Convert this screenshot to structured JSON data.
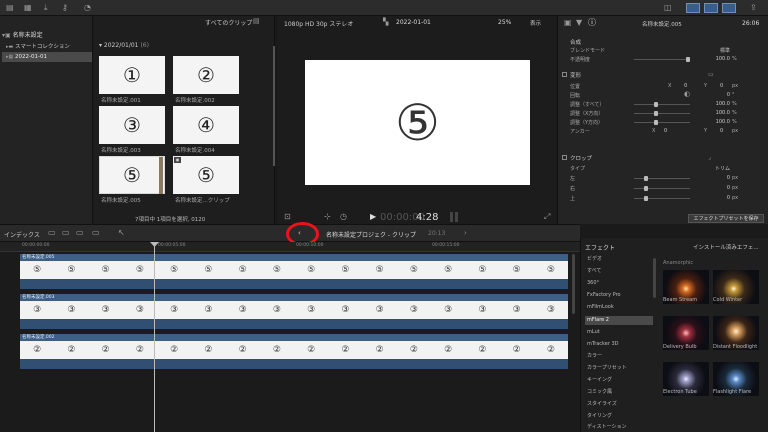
{
  "browser_header": {
    "dropdown": "すべてのクリップ"
  },
  "viewer_header": {
    "format": "1080p HD 30p ステレオ",
    "project": "2022-01-01",
    "zoom": "25%",
    "display": "表示"
  },
  "inspector_header": {
    "title": "名称未設定.005",
    "duration": "26:06"
  },
  "sidebar": {
    "library": "名称未設定",
    "items": [
      {
        "label": "スマートコレクション"
      },
      {
        "label": "2022-01-01"
      }
    ]
  },
  "browser": {
    "date_group": "2022/01/01",
    "date_count": "(6)",
    "clips": [
      {
        "glyph": "①",
        "caption": "名称未設定.001"
      },
      {
        "glyph": "②",
        "caption": "名称未設定.002"
      },
      {
        "glyph": "③",
        "caption": "名称未設定.003"
      },
      {
        "glyph": "④",
        "caption": "名称未設定.004"
      },
      {
        "glyph": "⑤",
        "caption": "名称未設定.005"
      },
      {
        "glyph": "⑤",
        "caption": "名称未設定...クリップ"
      }
    ],
    "status": "7項目中 1項目を選択, 0120"
  },
  "viewer": {
    "frame_glyph": "⑤",
    "timecode_dim": "00:00:00",
    "timecode": "4:28"
  },
  "inspector": {
    "sections": {
      "composite": "合成",
      "transform": "変形",
      "crop": "クロップ"
    },
    "rows": {
      "blend_mode": {
        "label": "ブレンドモード",
        "value": "標準"
      },
      "opacity": {
        "label": "不透明度",
        "value": "100.0",
        "unit": "%"
      },
      "position": {
        "label": "位置",
        "x": "X",
        "x_val": "0",
        "y": "Y",
        "y_val": "0",
        "unit": "px"
      },
      "rotation": {
        "label": "回転",
        "value": "0",
        "unit": "°"
      },
      "scale_all": {
        "label": "調整（すべて）",
        "value": "100.0",
        "unit": "%"
      },
      "scale_x": {
        "label": "調整（X方向）",
        "value": "100.0",
        "unit": "%"
      },
      "scale_y": {
        "label": "調整（Y方向）",
        "value": "100.0",
        "unit": "%"
      },
      "anchor": {
        "label": "アンカー",
        "x": "X",
        "x_val": "0",
        "y": "Y",
        "y_val": "0",
        "unit": "px"
      },
      "crop_type": {
        "label": "タイプ",
        "value": "トリム"
      },
      "crop_left": {
        "label": "左",
        "value": "0",
        "unit": "px"
      },
      "crop_right": {
        "label": "右",
        "value": "0",
        "unit": "px"
      },
      "crop_top": {
        "label": "上",
        "value": "0",
        "unit": "px"
      }
    },
    "save_preset": "エフェクトプリセットを保存"
  },
  "timeline_bar": {
    "index": "インデックス",
    "project_title": "名称未設定プロジェク - クリップ",
    "duration": "20:13"
  },
  "ruler": {
    "ticks": [
      "00:00:00:00",
      "00:00:05:00",
      "00:00:10:00",
      "00:00:15:00"
    ]
  },
  "tracks": [
    {
      "title": "名称未設定.005",
      "glyph": "⑤"
    },
    {
      "title": "名称未設定.003",
      "glyph": "③"
    },
    {
      "title": "名称未設定.002",
      "glyph": "②"
    }
  ],
  "effects": {
    "title": "エフェクト",
    "installed": "インストール済みエフェ...",
    "categories": [
      "ビデオ",
      "すべて",
      "360°",
      "FxFactory Pro",
      "mFilmLook",
      "mFlare 2",
      "mLut",
      "mTracker 3D",
      "カラー",
      "カラープリセット",
      "キーイング",
      "コミック風",
      "スタイライズ",
      "タイリング",
      "ディストーション"
    ],
    "group": "Anamorphic",
    "items": [
      {
        "name": "Beam Stream"
      },
      {
        "name": "Cold Winter"
      },
      {
        "name": "Delivery Bulb"
      },
      {
        "name": "Distant Floodlight"
      },
      {
        "name": "Electron Tube"
      },
      {
        "name": "Flashlight Flare"
      }
    ]
  },
  "colors": {
    "accent": "#3d5f86",
    "highlight_circle": "#e8141c"
  }
}
